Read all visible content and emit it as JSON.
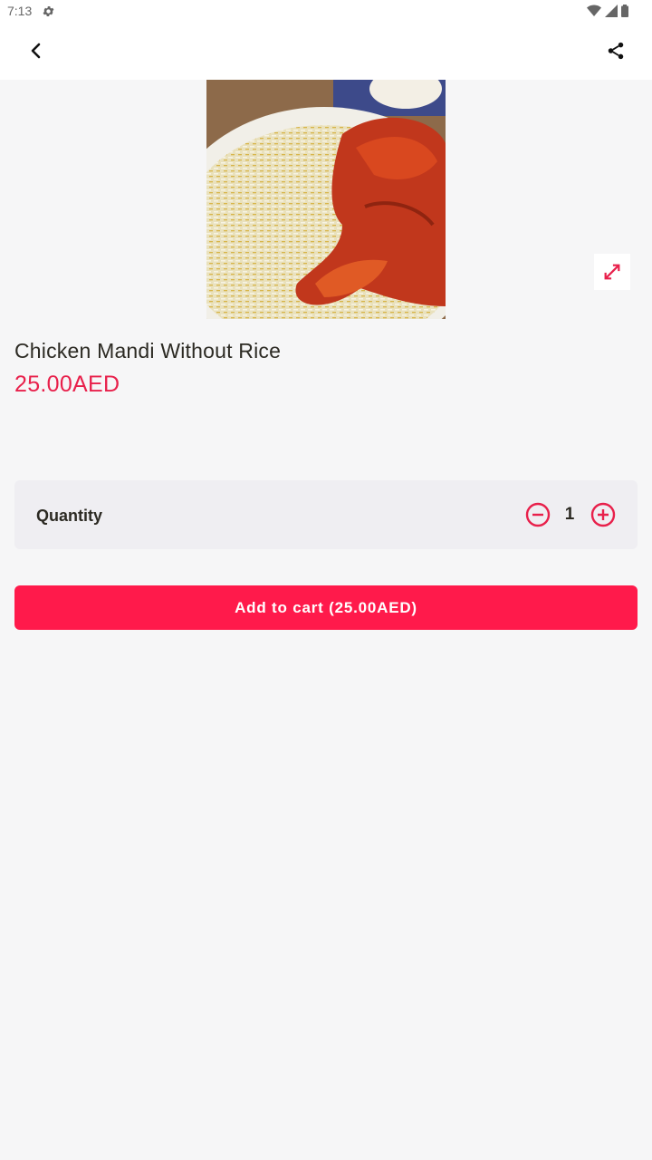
{
  "status_bar": {
    "time": "7:13"
  },
  "header": {
    "back_icon": "back-chevron-icon",
    "share_icon": "share-icon"
  },
  "product": {
    "image_description": "chicken-mandi-photo",
    "name": "Chicken Mandi Without Rice",
    "price": "25.00AED"
  },
  "quantity": {
    "label": "Quantity",
    "value": "1"
  },
  "cart": {
    "button_label": "Add to cart (25.00AED)"
  },
  "colors": {
    "accent": "#ff1a4b",
    "price": "#e8204b",
    "background": "#f6f6f7"
  }
}
